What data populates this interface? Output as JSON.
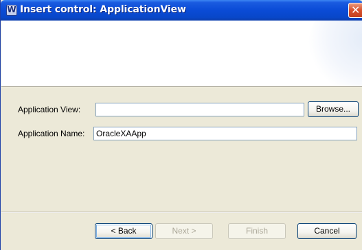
{
  "window": {
    "title": "Insert control: ApplicationView"
  },
  "form": {
    "application_view": {
      "label": "Application View:",
      "value": "",
      "browse_label": "Browse..."
    },
    "application_name": {
      "label": "Application Name:",
      "value": "OracleXAApp"
    }
  },
  "footer": {
    "back_label": "< Back",
    "next_label": "Next >",
    "finish_label": "Finish",
    "cancel_label": "Cancel"
  },
  "icons": {
    "app": "weblogic-w-icon",
    "close": "close-icon"
  },
  "colors": {
    "titlebar": "#0a4bd6",
    "close": "#d8512e",
    "dialog_bg": "#ece9d8"
  }
}
